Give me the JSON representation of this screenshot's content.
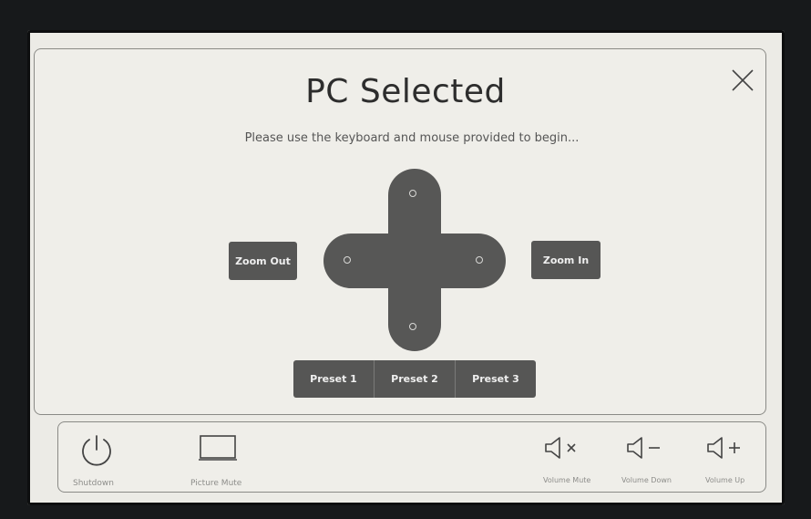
{
  "dialog": {
    "title": "PC Selected",
    "subtitle": "Please use the keyboard and mouse provided to begin...",
    "close_icon": "close-icon"
  },
  "camera": {
    "zoom_out_label": "Zoom Out",
    "zoom_in_label": "Zoom In",
    "presets": [
      "Preset 1",
      "Preset 2",
      "Preset 3"
    ]
  },
  "bottom_bar": {
    "shutdown_label": "Shutdown",
    "picture_mute_label": "Picture Mute",
    "volume_mute_label": "Volume Mute",
    "volume_down_label": "Volume Down",
    "volume_up_label": "Volume Up"
  },
  "colors": {
    "screen_bg": "#ecebe6",
    "button_bg": "#565655",
    "outline": "#8a8a86"
  }
}
